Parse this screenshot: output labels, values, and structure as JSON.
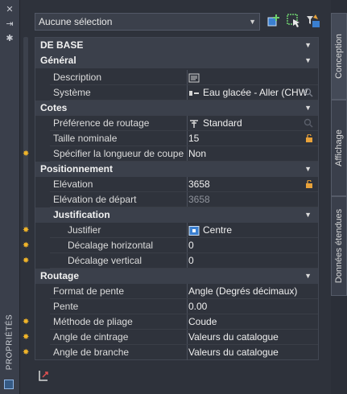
{
  "window": {
    "vertical_title": "PROPRIÉTÉS"
  },
  "selection": {
    "value": "Aucune sélection"
  },
  "tabs": [
    {
      "label": "Conception",
      "active": true
    },
    {
      "label": "Affichage",
      "active": false
    },
    {
      "label": "Données étendues",
      "active": false
    }
  ],
  "sections": {
    "base": {
      "title": "DE BASE"
    },
    "general": {
      "title": "Général",
      "description_label": "Description",
      "systeme_label": "Système",
      "systeme_value": "Eau glacée - Aller (CHW"
    },
    "cotes": {
      "title": "Cotes",
      "pref_label": "Préférence de routage",
      "pref_value": "Standard",
      "taille_label": "Taille nominale",
      "taille_value": "15",
      "longueur_label": "Spécifier la longueur de coupe",
      "longueur_value": "Non"
    },
    "positionnement": {
      "title": "Positionnement",
      "elev_label": "Elévation",
      "elev_value": "3658",
      "elev_depart_label": "Elévation de départ",
      "elev_depart_value": "3658",
      "justification_title": "Justification",
      "justifier_label": "Justifier",
      "justifier_value": "Centre",
      "dec_h_label": "Décalage horizontal",
      "dec_h_value": "0",
      "dec_v_label": "Décalage vertical",
      "dec_v_value": "0"
    },
    "routage": {
      "title": "Routage",
      "format_label": "Format de pente",
      "format_value": "Angle (Degrés décimaux)",
      "pente_label": "Pente",
      "pente_value": "0.00",
      "pliage_label": "Méthode de pliage",
      "pliage_value": "Coude",
      "cintrage_label": "Angle de cintrage",
      "cintrage_value": "Valeurs du catalogue",
      "branche_label": "Angle de branche",
      "branche_value": "Valeurs du catalogue"
    }
  },
  "colors": {
    "background": "#2e323b",
    "category_band": "#3b404b",
    "required_star": "#f0b429",
    "lock": "#e8a23a"
  }
}
